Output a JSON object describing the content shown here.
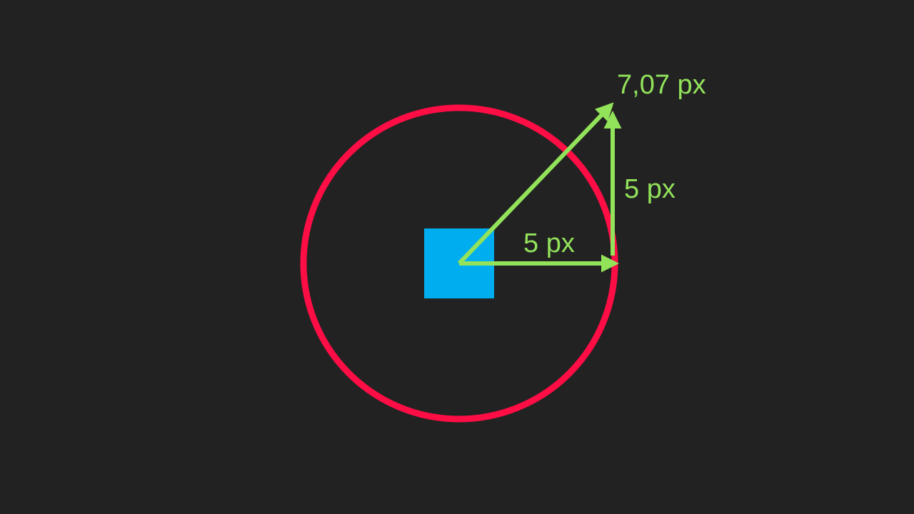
{
  "colors": {
    "background": "#222222",
    "circle": "#ff0d45",
    "square": "#00adef",
    "arrows": "#92e25a"
  },
  "labels": {
    "horizontal": "5 px",
    "vertical": "5 px",
    "diagonal": "7,07 px"
  }
}
